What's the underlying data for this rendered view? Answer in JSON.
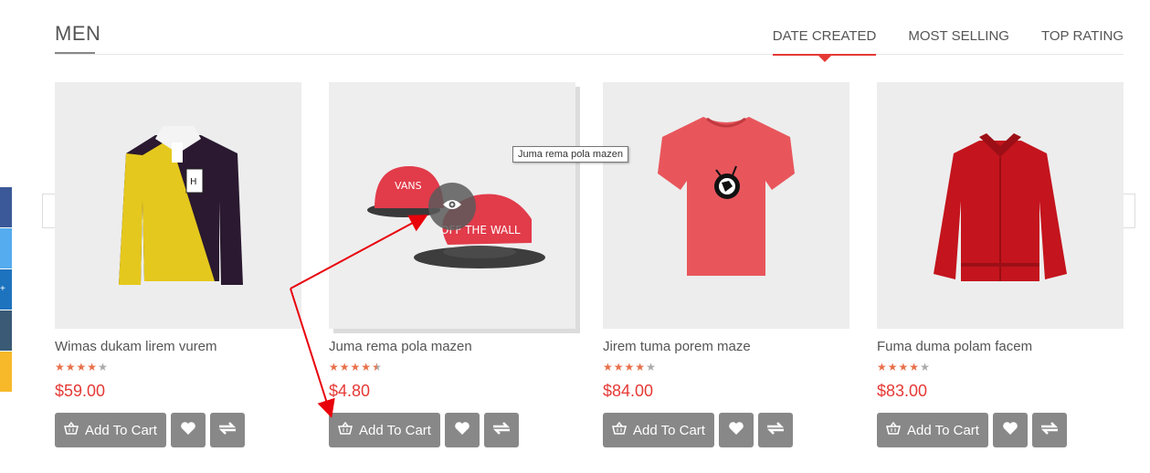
{
  "section": {
    "title": "MEN"
  },
  "tabs": [
    {
      "label": "DATE CREATED",
      "active": true
    },
    {
      "label": "MOST SELLING",
      "active": false
    },
    {
      "label": "TOP RATING",
      "active": false
    }
  ],
  "products": [
    {
      "name": "Wimas dukam lirem vurem",
      "price": "$59.00",
      "rating": 4,
      "add_to_cart": "Add To Cart"
    },
    {
      "name": "Juma rema pola mazen",
      "price": "$4.80",
      "rating": 4.5,
      "add_to_cart": "Add To Cart"
    },
    {
      "name": "Jirem tuma porem maze",
      "price": "$84.00",
      "rating": 4,
      "add_to_cart": "Add To Cart"
    },
    {
      "name": "Fuma duma polam facem",
      "price": "$83.00",
      "rating": 4,
      "add_to_cart": "Add To Cart"
    }
  ],
  "tooltip": {
    "text": "Juma rema pola mazen"
  },
  "colors": {
    "accent": "#e53935",
    "star": "#e8704a",
    "button": "#888888",
    "annotation": "#e8000b",
    "social": [
      "#3b5998",
      "#55acee",
      "#1e73be",
      "#3a5a75",
      "#f7b92a"
    ]
  }
}
